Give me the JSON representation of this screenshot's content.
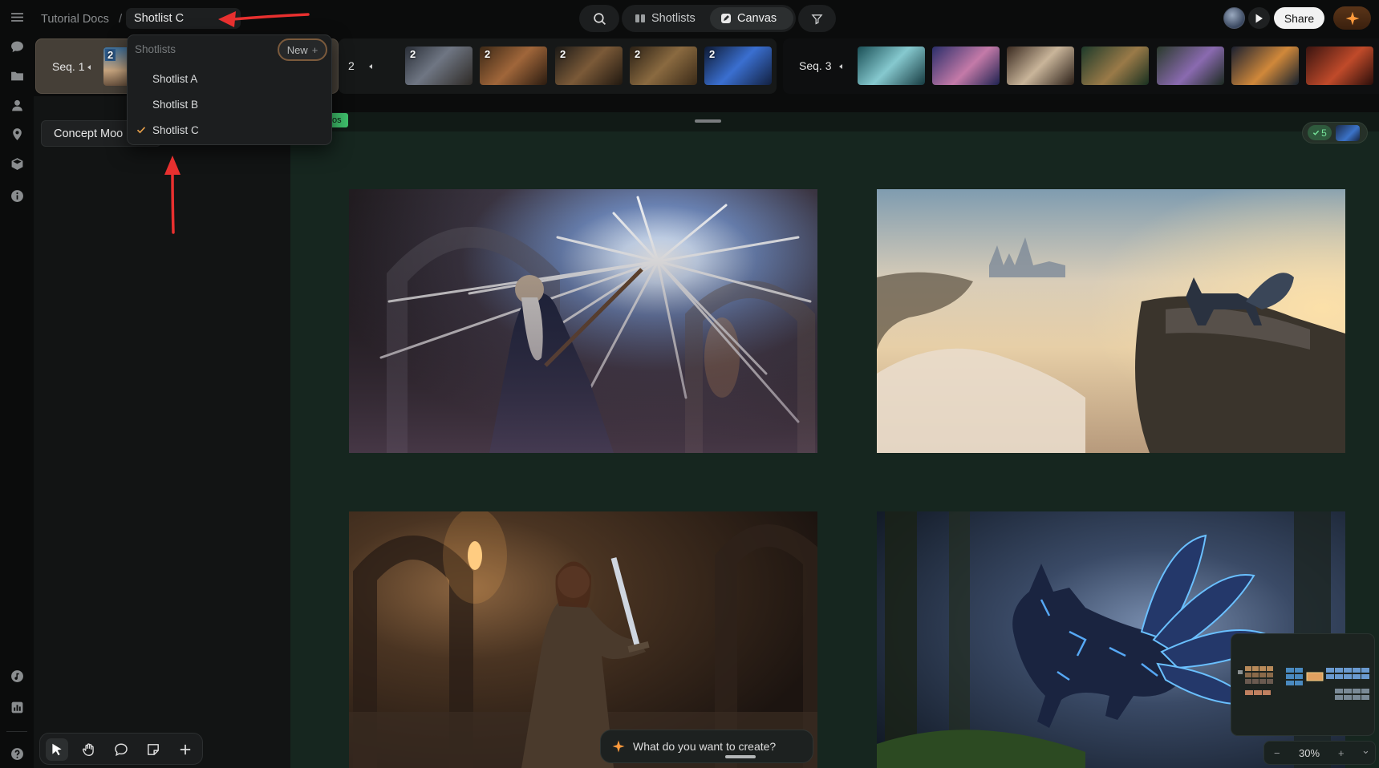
{
  "topbar": {
    "breadcrumb_root": "Tutorial Docs",
    "breadcrumb_separator": "/",
    "current_shotlist": "Shotlist C",
    "view_shotlists": "Shotlists",
    "view_canvas": "Canvas",
    "share_label": "Share"
  },
  "sequences": [
    {
      "label": "Seq. 1",
      "thumb_counts": [
        "2"
      ]
    },
    {
      "label": "2",
      "thumb_counts": [
        "2",
        "2",
        "2",
        "2",
        "2"
      ],
      "add": "+"
    },
    {
      "label": "Seq. 3"
    }
  ],
  "dropdown": {
    "header": "Shotlists",
    "new_label": "New",
    "new_icon": "+",
    "items": [
      {
        "label": "Shotlist A",
        "selected": false
      },
      {
        "label": "Shotlist B",
        "selected": false
      },
      {
        "label": "Shotlist C",
        "selected": true
      }
    ]
  },
  "left_panel": {
    "title": "Concept Moo"
  },
  "canvas": {
    "tag": "os",
    "badge_count": "5"
  },
  "prompt": {
    "placeholder": "What do you want to create?"
  },
  "zoom": {
    "minus": "−",
    "level": "30%",
    "plus": "+",
    "chevron": "⌄"
  },
  "colors": {
    "accent_green": "#3fbf6b",
    "annotation_red": "#e8302f",
    "new_button_border": "#7b5a3c",
    "canvas_bg": "#16261f"
  },
  "icons": {
    "rail": [
      "menu-icon",
      "chat-icon",
      "folder-icon",
      "user-icon",
      "location-icon",
      "cube-icon",
      "info-icon",
      "music-icon",
      "stats-icon",
      "help-icon"
    ],
    "tools": [
      "pointer-icon",
      "hand-icon",
      "comment-icon",
      "sticky-note-icon",
      "plus-icon"
    ]
  }
}
